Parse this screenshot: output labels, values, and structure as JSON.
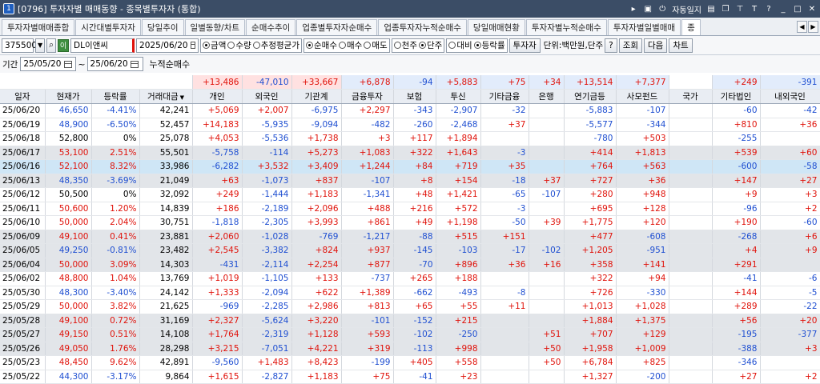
{
  "window": {
    "badge": "1",
    "title": "[0796] 투자자별 매매동향 - 종목별투자자 (통합)",
    "auto_close": "자동일지",
    "btn_t": "T",
    "btn_q": "?"
  },
  "tabs": [
    "투자자별매매종합",
    "시간대별투자자",
    "당일추이",
    "일별동향/차트",
    "순매수추이",
    "업종별투자자순매수",
    "업종투자자누적순매수",
    "당일매매현황",
    "투자자별누적순매수",
    "투자자별일별매매",
    "종"
  ],
  "toolbar": {
    "code": "375500",
    "stock_name": "DL이앤씨",
    "logo_char": "이",
    "date": "2025/06/20",
    "amount_group": [
      {
        "label": "금액",
        "on": true
      },
      {
        "label": "수량",
        "on": false
      },
      {
        "label": "추정평균가",
        "on": false
      }
    ],
    "trade_group": [
      {
        "label": "순매수",
        "on": true
      },
      {
        "label": "매수",
        "on": false
      },
      {
        "label": "매도",
        "on": false
      }
    ],
    "unit_group": [
      {
        "label": "천주",
        "on": false
      },
      {
        "label": "단주",
        "on": true
      }
    ],
    "compare_group": [
      {
        "label": "대비",
        "on": false
      },
      {
        "label": "등락률",
        "on": true
      }
    ],
    "investor_btn": "투자자",
    "unit_label": "단위:백만원,단주",
    "help_btn": "?",
    "query_btn": "조회",
    "next_btn": "다음",
    "chart_btn": "차트"
  },
  "period": {
    "label": "기간",
    "from": "25/05/20",
    "to": "25/06/20",
    "sum_label": "누적순매수"
  },
  "summary": [
    "+13,486",
    "-47,010",
    "+33,667",
    "+6,878",
    "-94",
    "+5,883",
    "+75",
    "+34",
    "+13,514",
    "+7,377",
    "",
    "+249",
    "-391"
  ],
  "columns": [
    "일자",
    "현재가",
    "등락률",
    "거래대금",
    "개인",
    "외국인",
    "기관계",
    "금융투자",
    "보험",
    "투신",
    "기타금융",
    "은행",
    "연기금등",
    "사모펀드",
    "국가",
    "기타법인",
    "내외국인"
  ],
  "rows": [
    {
      "style": "",
      "cells": [
        "25/06/20",
        "46,650",
        "-4.41%",
        "42,241",
        "+5,069",
        "+2,007",
        "-6,975",
        "+2,297",
        "-343",
        "-2,907",
        "-32",
        "",
        "-5,883",
        "-107",
        "",
        "-60",
        "-42"
      ]
    },
    {
      "style": "",
      "cells": [
        "25/06/19",
        "48,900",
        "-6.50%",
        "52,457",
        "+14,183",
        "-5,935",
        "-9,094",
        "-482",
        "-260",
        "-2,468",
        "+37",
        "",
        "-5,577",
        "-344",
        "",
        "+810",
        "+36"
      ]
    },
    {
      "style": "",
      "cells": [
        "25/06/18",
        "52,800",
        "0%",
        "25,078",
        "+4,053",
        "-5,536",
        "+1,738",
        "+3",
        "+117",
        "+1,894",
        "",
        "",
        "-780",
        "+503",
        "",
        "-255",
        ""
      ]
    },
    {
      "style": "shade",
      "cells": [
        "25/06/17",
        "53,100",
        "2.51%",
        "55,501",
        "-5,758",
        "-114",
        "+5,273",
        "+1,083",
        "+322",
        "+1,643",
        "-3",
        "",
        "+414",
        "+1,813",
        "",
        "+539",
        "+60"
      ]
    },
    {
      "style": "sel",
      "cells": [
        "25/06/16",
        "52,100",
        "8.32%",
        "33,986",
        "-6,282",
        "+3,532",
        "+3,409",
        "+1,244",
        "+84",
        "+719",
        "+35",
        "",
        "+764",
        "+563",
        "",
        "-600",
        "-58"
      ]
    },
    {
      "style": "shade",
      "cells": [
        "25/06/13",
        "48,350",
        "-3.69%",
        "21,049",
        "+63",
        "-1,073",
        "+837",
        "-107",
        "+8",
        "+154",
        "-18",
        "+37",
        "+727",
        "+36",
        "",
        "+147",
        "+27"
      ]
    },
    {
      "style": "",
      "cells": [
        "25/06/12",
        "50,500",
        "0%",
        "32,092",
        "+249",
        "-1,444",
        "+1,183",
        "-1,341",
        "+48",
        "+1,421",
        "-65",
        "-107",
        "+280",
        "+948",
        "",
        "+9",
        "+3"
      ]
    },
    {
      "style": "",
      "cells": [
        "25/06/11",
        "50,600",
        "1.20%",
        "14,839",
        "+186",
        "-2,189",
        "+2,096",
        "+488",
        "+216",
        "+572",
        "-3",
        "",
        "+695",
        "+128",
        "",
        "-96",
        "+2"
      ]
    },
    {
      "style": "",
      "cells": [
        "25/06/10",
        "50,000",
        "2.04%",
        "30,751",
        "-1,818",
        "-2,305",
        "+3,993",
        "+861",
        "+49",
        "+1,198",
        "-50",
        "+39",
        "+1,775",
        "+120",
        "",
        "+190",
        "-60"
      ]
    },
    {
      "style": "shade",
      "cells": [
        "25/06/09",
        "49,100",
        "0.41%",
        "23,881",
        "+2,060",
        "-1,028",
        "-769",
        "-1,217",
        "-88",
        "+515",
        "+151",
        "",
        "+477",
        "-608",
        "",
        "-268",
        "+6"
      ]
    },
    {
      "style": "shade",
      "cells": [
        "25/06/05",
        "49,250",
        "-0.81%",
        "23,482",
        "+2,545",
        "-3,382",
        "+824",
        "+937",
        "-145",
        "-103",
        "-17",
        "-102",
        "+1,205",
        "-951",
        "",
        "+4",
        "+9"
      ]
    },
    {
      "style": "shade",
      "cells": [
        "25/06/04",
        "50,000",
        "3.09%",
        "14,303",
        "-431",
        "-2,114",
        "+2,254",
        "+877",
        "-70",
        "+896",
        "+36",
        "+16",
        "+358",
        "+141",
        "",
        "+291",
        ""
      ]
    },
    {
      "style": "",
      "cells": [
        "25/06/02",
        "48,800",
        "1.04%",
        "13,769",
        "+1,019",
        "-1,105",
        "+133",
        "-737",
        "+265",
        "+188",
        "",
        "",
        "+322",
        "+94",
        "",
        "-41",
        "-6"
      ]
    },
    {
      "style": "",
      "cells": [
        "25/05/30",
        "48,300",
        "-3.40%",
        "24,142",
        "+1,333",
        "-2,094",
        "+622",
        "+1,389",
        "-662",
        "-493",
        "-8",
        "",
        "+726",
        "-330",
        "",
        "+144",
        "-5"
      ]
    },
    {
      "style": "",
      "cells": [
        "25/05/29",
        "50,000",
        "3.82%",
        "21,625",
        "-969",
        "-2,285",
        "+2,986",
        "+813",
        "+65",
        "+55",
        "+11",
        "",
        "+1,013",
        "+1,028",
        "",
        "+289",
        "-22"
      ]
    },
    {
      "style": "shade",
      "cells": [
        "25/05/28",
        "49,100",
        "0.72%",
        "31,169",
        "+2,327",
        "-5,624",
        "+3,220",
        "-101",
        "-152",
        "+215",
        "",
        "",
        "+1,884",
        "+1,375",
        "",
        "+56",
        "+20"
      ]
    },
    {
      "style": "shade",
      "cells": [
        "25/05/27",
        "49,150",
        "0.51%",
        "14,108",
        "+1,764",
        "-2,319",
        "+1,128",
        "+593",
        "-102",
        "-250",
        "",
        "+51",
        "+707",
        "+129",
        "",
        "-195",
        "-377"
      ]
    },
    {
      "style": "shade",
      "cells": [
        "25/05/26",
        "49,050",
        "1.76%",
        "28,298",
        "+3,215",
        "-7,051",
        "+4,221",
        "+319",
        "-113",
        "+998",
        "",
        "+50",
        "+1,958",
        "+1,009",
        "",
        "-388",
        "+3"
      ]
    },
    {
      "style": "",
      "cells": [
        "25/05/23",
        "48,450",
        "9.62%",
        "42,891",
        "-9,560",
        "+1,483",
        "+8,423",
        "-199",
        "+405",
        "+558",
        "",
        "+50",
        "+6,784",
        "+825",
        "",
        "-346",
        ""
      ]
    },
    {
      "style": "",
      "cells": [
        "25/05/22",
        "44,300",
        "-3.17%",
        "9,864",
        "+1,615",
        "-2,827",
        "+1,183",
        "+75",
        "-41",
        "+23",
        "",
        "",
        "+1,327",
        "-200",
        "",
        "+27",
        "+2"
      ]
    }
  ]
}
